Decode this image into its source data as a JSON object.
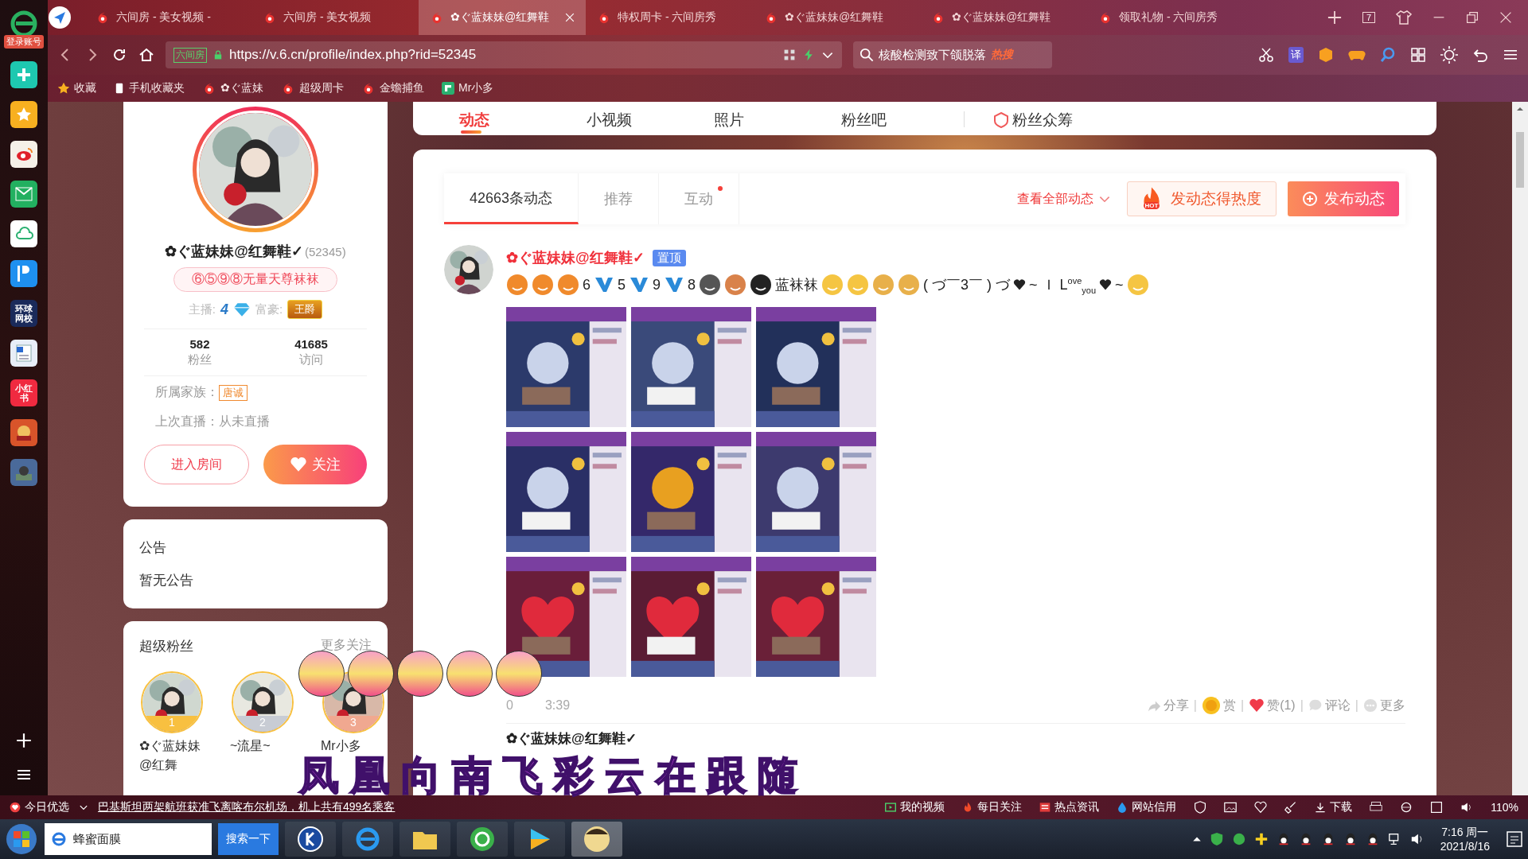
{
  "browser": {
    "tabs": [
      {
        "title": "六间房 - 美女视频 -",
        "selected": false
      },
      {
        "title": "六间房 - 美女视频",
        "selected": false
      },
      {
        "title": "✿ぐ蓝妹妹@红舞鞋",
        "selected": true
      },
      {
        "title": "特权周卡 - 六间房秀",
        "selected": false
      },
      {
        "title": "✿ぐ蓝妹妹@红舞鞋",
        "selected": false
      },
      {
        "title": "✿ぐ蓝妹妹@红舞鞋",
        "selected": false
      },
      {
        "title": "领取礼物 - 六间房秀",
        "selected": false
      }
    ],
    "tab_count": "7",
    "site_badge": "六间房",
    "url": "https://v.6.cn/profile/index.php?rid=52345",
    "search_value": "核酸检测致下颌脱落",
    "search_tag": "热搜",
    "translate_label": "译",
    "bookmarks": [
      {
        "label": "收藏",
        "kind": "star"
      },
      {
        "label": "手机收藏夹",
        "kind": "phone"
      },
      {
        "label": "✿ぐ蓝妹",
        "kind": "site"
      },
      {
        "label": "超级周卡",
        "kind": "site"
      },
      {
        "label": "金蟾捕鱼",
        "kind": "site"
      },
      {
        "label": "Mr小多",
        "kind": "app"
      }
    ]
  },
  "sidebar": {
    "login": "登录账号",
    "apps": [
      {
        "kind": "plus"
      },
      {
        "kind": "star"
      },
      {
        "kind": "weibo"
      },
      {
        "kind": "mail"
      },
      {
        "kind": "cloud"
      },
      {
        "kind": "reader"
      },
      {
        "kind": "school",
        "label": "环球网校"
      },
      {
        "kind": "doc"
      },
      {
        "kind": "redbook",
        "label": "小红书"
      },
      {
        "kind": "game"
      },
      {
        "kind": "game2"
      }
    ]
  },
  "profile_nav": {
    "items": [
      {
        "label": "动态",
        "selected": true
      },
      {
        "label": "小视频",
        "selected": false
      },
      {
        "label": "照片",
        "selected": false
      },
      {
        "label": "粉丝吧",
        "selected": false
      },
      {
        "label": "粉丝众筹",
        "selected": false
      }
    ]
  },
  "profile": {
    "name": "✿ぐ蓝妹妹@红舞鞋✓",
    "id": "(52345)",
    "signature": "⑥⑤⑨⑧无量天尊袜袜",
    "anchor_label": "主播:",
    "anchor_level": "4",
    "rich_label": "富豪:",
    "rich_badge": "王爵",
    "stats": [
      {
        "value": "582",
        "label": "粉丝"
      },
      {
        "value": "41685",
        "label": "访问"
      }
    ],
    "family_label": "所属家族：",
    "family_badge": "唐诚",
    "last_live": "上次直播：从未直播",
    "buttons": [
      {
        "label": "进入房间",
        "kind": "outline"
      },
      {
        "label": "关注",
        "kind": "follow"
      }
    ]
  },
  "notice": {
    "title": "公告",
    "text": "暂无公告"
  },
  "super_fans": {
    "title": "超级粉丝",
    "more": "更多关注",
    "fans": [
      {
        "rank": "1",
        "name": "✿ぐ蓝妹妹@红舞"
      },
      {
        "rank": "2",
        "name": "~流星~"
      },
      {
        "rank": "3",
        "name": "Mr小多"
      }
    ]
  },
  "feed": {
    "tabs": [
      {
        "label": "42663条动态",
        "selected": true,
        "has_new": false
      },
      {
        "label": "推荐",
        "selected": false,
        "has_new": false
      },
      {
        "label": "互动",
        "selected": false,
        "has_new": true
      }
    ],
    "view_all": "查看全部动态",
    "hot_tag": "HOT",
    "heat_button": "发动态得热度",
    "post_button": "发布动态",
    "posts": [
      {
        "author": "✿ぐ蓝妹妹@红舞鞋✓",
        "pinned": "置顶",
        "content": [
          {
            "kind": "sticker",
            "color": "#f08a2c"
          },
          {
            "kind": "sticker",
            "color": "#f08a2c"
          },
          {
            "kind": "sticker",
            "color": "#f08a2c"
          },
          {
            "kind": "text",
            "text": "6"
          },
          {
            "kind": "level"
          },
          {
            "kind": "text",
            "text": "5"
          },
          {
            "kind": "level"
          },
          {
            "kind": "text",
            "text": "9"
          },
          {
            "kind": "level"
          },
          {
            "kind": "text",
            "text": "8"
          },
          {
            "kind": "sticker",
            "color": "#555555"
          },
          {
            "kind": "sticker",
            "color": "#d9824a"
          },
          {
            "kind": "sticker",
            "color": "#222222"
          },
          {
            "kind": "text",
            "text": "蓝袜袜"
          },
          {
            "kind": "sticker",
            "color": "#f5c542"
          },
          {
            "kind": "sticker",
            "color": "#f5c542"
          },
          {
            "kind": "sticker",
            "color": "#e8b04a"
          },
          {
            "kind": "sticker",
            "color": "#e8b04a"
          },
          {
            "kind": "text",
            "text": "( づ￣3￣ ) づ"
          },
          {
            "kind": "heart"
          },
          {
            "kind": "text",
            "text": "~ Ｉ L$^{ove}$$_{you}$"
          },
          {
            "kind": "heart"
          },
          {
            "kind": "text",
            "text": "~"
          },
          {
            "kind": "sticker",
            "color": "#f5c542"
          }
        ],
        "images": [
          {
            "kind": "picture"
          },
          {
            "kind": "picture"
          },
          {
            "kind": "picture"
          },
          {
            "kind": "picture"
          },
          {
            "kind": "picture"
          },
          {
            "kind": "picture"
          },
          {
            "kind": "picture"
          },
          {
            "kind": "picture"
          },
          {
            "kind": "picture"
          }
        ],
        "time_parts": [
          "0",
          "3:39"
        ],
        "separator": "|",
        "actions": [
          {
            "label": "分享",
            "kind": "share"
          },
          {
            "label": "赏",
            "kind": "reward"
          },
          {
            "label": "赞(1)",
            "kind": "like"
          },
          {
            "label": "评论",
            "kind": "comment"
          },
          {
            "label": "更多",
            "kind": "more"
          }
        ]
      },
      {
        "author": "✿ぐ蓝妹妹@红舞鞋✓"
      }
    ]
  },
  "status_bar": {
    "today": "今日优选",
    "news": "巴基斯坦两架航班获准飞离喀布尔机场，机上共有499名乘客",
    "links": [
      {
        "label": "我的视频",
        "kind": "video"
      },
      {
        "label": "每日关注",
        "kind": "fire"
      },
      {
        "label": "热点资讯",
        "kind": "news"
      },
      {
        "label": "网站信用",
        "kind": "drop"
      }
    ],
    "download": "下载",
    "zoom": "110%"
  },
  "taskbar": {
    "search_value": "蜂蜜面膜",
    "search_button": "搜索一下",
    "time": "7:16 周一",
    "date": "2021/8/16"
  },
  "lyrics_overlay": "凤凰向南飞彩云在跟随"
}
